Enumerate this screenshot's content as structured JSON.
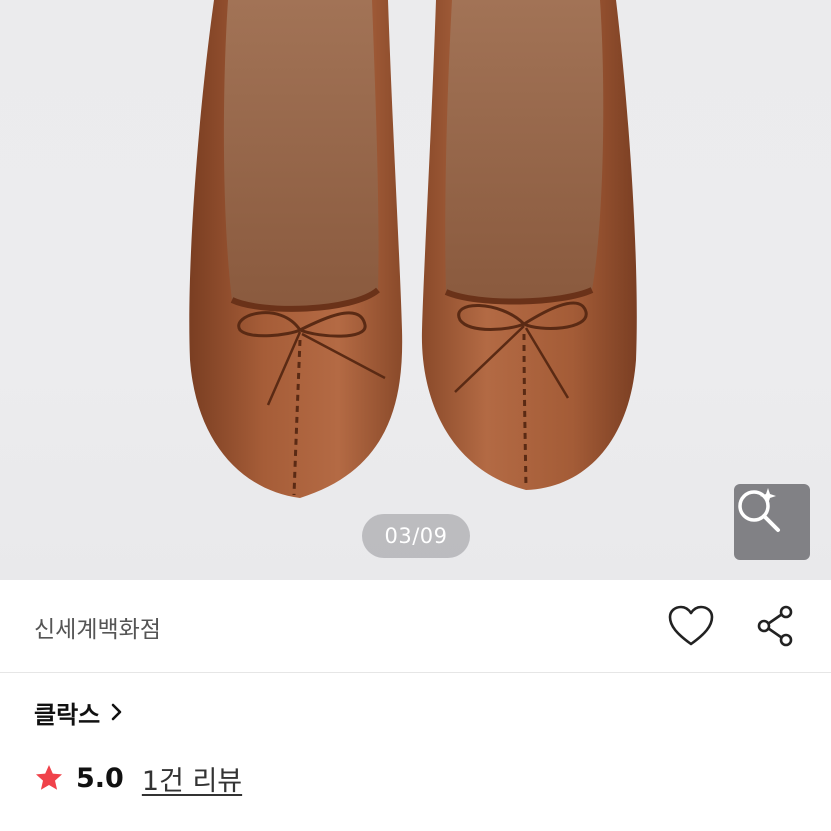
{
  "gallery": {
    "counter": "03/09",
    "lens_icon": "image-search-icon"
  },
  "seller": {
    "name": "신세계백화점",
    "like_icon": "heart-icon",
    "share_icon": "share-icon"
  },
  "brand": {
    "name": "클락스",
    "chevron_icon": "chevron-right-icon"
  },
  "rating": {
    "star_icon": "star-icon",
    "star_color": "#f0424a",
    "score": "5.0",
    "review_link": "1건 리뷰"
  }
}
